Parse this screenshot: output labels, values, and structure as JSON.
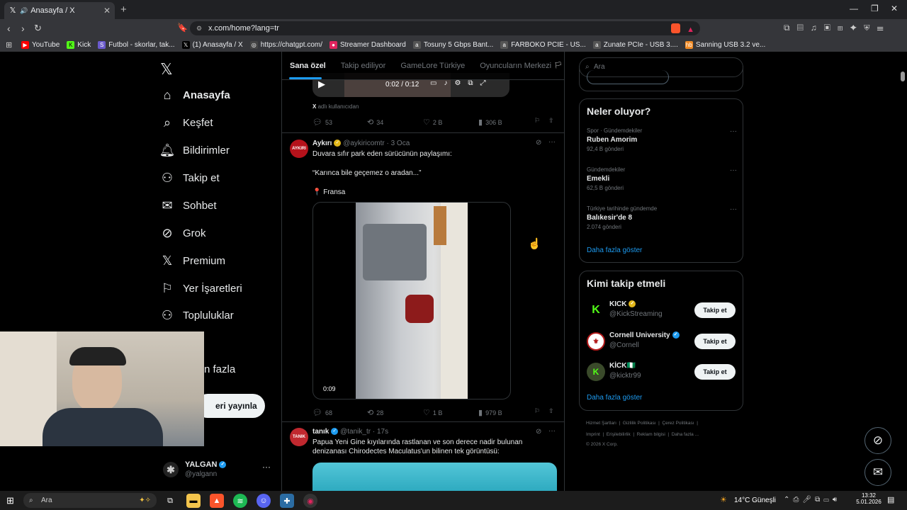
{
  "browser": {
    "tab_title": "Anasayfa / X",
    "url": "x.com/home?lang=tr",
    "bookmarks": [
      {
        "label": "YouTube",
        "color": "#ff0000"
      },
      {
        "label": "Kick",
        "color": "#53fc18"
      },
      {
        "label": "Futbol - skorlar, tak...",
        "color": "#6a5acd"
      },
      {
        "label": "(1) Anasayfa / X",
        "color": "#000000"
      },
      {
        "label": "https://chatgpt.com/",
        "color": "#444444"
      },
      {
        "label": "Streamer Dashboard",
        "color": "#e0245e"
      },
      {
        "label": "Tosuny 5 Gbps Bant...",
        "color": "#555555"
      },
      {
        "label": "FARBOKO PCIE - US...",
        "color": "#555555"
      },
      {
        "label": "Zunate PCIe - USB 3....",
        "color": "#555555"
      },
      {
        "label": "Sanning USB 3.2 ve...",
        "color": "#f08a24"
      }
    ]
  },
  "nav": {
    "items": [
      {
        "label": "Anasayfa",
        "icon": "home-icon"
      },
      {
        "label": "Keşfet",
        "icon": "search-icon"
      },
      {
        "label": "Bildirimler",
        "icon": "bell-icon"
      },
      {
        "label": "Takip et",
        "icon": "follow-icon"
      },
      {
        "label": "Sohbet",
        "icon": "mail-icon"
      },
      {
        "label": "Grok",
        "icon": "grok-icon"
      },
      {
        "label": "Premium",
        "icon": "x-icon"
      },
      {
        "label": "Yer İşaretleri",
        "icon": "bookmark-icon"
      },
      {
        "label": "Topluluklar",
        "icon": "community-icon"
      }
    ],
    "more_label": "n fazla",
    "post_label": "eri yayınla",
    "profile_name": "YALGAN",
    "profile_handle": "@yalgann"
  },
  "feed": {
    "tabs": [
      "Sana özel",
      "Takip ediliyor",
      "GameLore Türkiye",
      "Oyuncuların Merkezi"
    ],
    "tweet0": {
      "time": "0:02 / 0:12",
      "source_x": "X",
      "source_text": "adlı kullanıcıdan",
      "replies": "53",
      "reposts": "34",
      "likes": "2 B",
      "views": "306 B"
    },
    "tweet1": {
      "avatar": "AYKIRI",
      "name": "Aykırı",
      "handle": "@aykiricomtr",
      "date": "· 3 Oca",
      "line1": "Duvara sıfır park eden sürücünün paylaşımı:",
      "line2": "“Karınca bile geçemez o aradan...”",
      "line3": "📍 Fransa",
      "duration": "0:09",
      "replies": "68",
      "reposts": "28",
      "likes": "1 B",
      "views": "979 B"
    },
    "tweet2": {
      "avatar": "TANIK",
      "name": "tanık",
      "handle": "@tanik_tr",
      "date": "· 17s",
      "line1": "Papua Yeni Gine kıyılarında rastlanan ve son derece nadir bulunan",
      "line2": "denizanası Chirodectes Maculatus'un bilinen tek görüntüsü:"
    }
  },
  "right": {
    "search_placeholder": "Ara",
    "trends_title": "Neler oluyor?",
    "trends": [
      {
        "context": "Spor · Gündemdekiler",
        "name": "Ruben Amorim",
        "count": "92,4 B gönderi"
      },
      {
        "context": "Gündemdekiler",
        "name": "Emekli",
        "count": "62,5 B gönderi"
      },
      {
        "context": "Türkiye tarihinde gündemde",
        "name": "Balıkesir'de 8",
        "count": "2.074 gönderi"
      }
    ],
    "show_more": "Daha fazla göster",
    "who_title": "Kimi takip etmeli",
    "who": [
      {
        "name": "KICK",
        "handle": "@KickStreaming",
        "badge": "gold"
      },
      {
        "name": "Cornell University",
        "handle": "@Cornell",
        "badge": "blue"
      },
      {
        "name": "KİCK🇳🇬",
        "handle": "@kicktr99",
        "badge": ""
      }
    ],
    "follow_label": "Takip et",
    "footer_line1": [
      "Hizmet Şartları",
      "Gizlilik Politikası",
      "Çerez Politikası"
    ],
    "footer_line2": [
      "Imprint",
      "Erişilebilirlik",
      "Reklam bilgisi",
      "Daha fazla ..."
    ],
    "copyright": "© 2026 X Corp."
  },
  "taskbar": {
    "search": "Ara",
    "weather": "14°C Güneşli",
    "time": "13:32",
    "date": "5.01.2026"
  }
}
